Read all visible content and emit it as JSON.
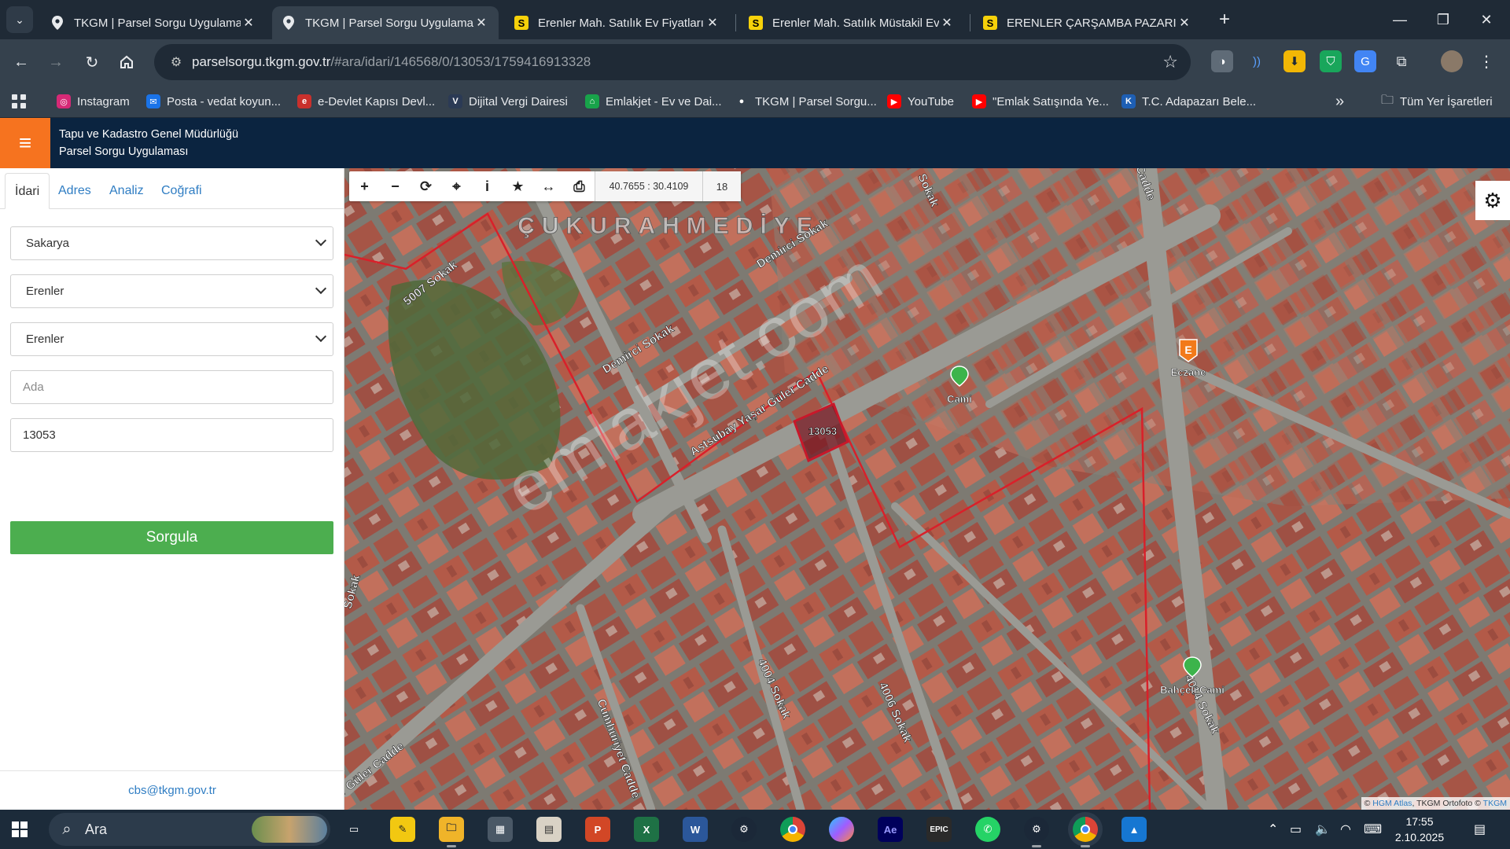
{
  "browser": {
    "tabs": [
      {
        "title": "TKGM | Parsel Sorgu Uygulaması",
        "favicon": "map-pin-icon",
        "active": false
      },
      {
        "title": "TKGM | Parsel Sorgu Uygulaması",
        "favicon": "map-pin-icon",
        "active": true
      },
      {
        "title": "Erenler Mah. Satılık Ev Fiyatları s",
        "favicon": "sahibinden-icon",
        "active": false
      },
      {
        "title": "Erenler Mah. Satılık Müstakil Ev",
        "favicon": "sahibinden-icon",
        "active": false
      },
      {
        "title": "ERENLER ÇARŞAMBA PAZARI M",
        "favicon": "sahibinden-icon",
        "active": false
      }
    ],
    "favicon_letter": "S",
    "url_host": "parselsorgu.tkgm.gov.tr",
    "url_path": "/#ara/idari/146568/0/13053/1759416913328",
    "bookmarks": [
      {
        "label": "Instagram",
        "icon": "instagram-icon",
        "color": "#d62976"
      },
      {
        "label": "Posta - vedat koyun...",
        "icon": "mail-icon",
        "color": "#1a73e8"
      },
      {
        "label": "e-Devlet Kapısı Devl...",
        "icon": "edevlet-icon",
        "color": "#c9302c"
      },
      {
        "label": "Dijital Vergi Dairesi",
        "icon": "vergi-icon",
        "color": "#2b3a55"
      },
      {
        "label": "Emlakjet - Ev ve Dai...",
        "icon": "emlakjet-icon",
        "color": "#18a34a"
      },
      {
        "label": "TKGM | Parsel Sorgu...",
        "icon": "map-pin-icon",
        "color": "#555"
      },
      {
        "label": "YouTube",
        "icon": "youtube-icon",
        "color": "#ff0000"
      },
      {
        "label": "\"Emlak Satışında Ye...",
        "icon": "youtube-icon",
        "color": "#ff0000"
      },
      {
        "label": "T.C. Adapazarı Bele...",
        "icon": "belediye-icon",
        "color": "#1e5fb4"
      }
    ],
    "bookmarks_more": "»",
    "all_bookmarks": "Tüm Yer İşaretleri"
  },
  "app": {
    "title_line1": "Tapu ve Kadastro Genel Müdürlüğü",
    "title_line2": "Parsel Sorgu Uygulaması"
  },
  "sidebar": {
    "tabs": [
      "İdari",
      "Adres",
      "Analiz",
      "Coğrafi"
    ],
    "active_tab": "İdari",
    "il": "Sakarya",
    "ilce": "Erenler",
    "mahalle": "Erenler",
    "ada_placeholder": "Ada",
    "parsel_value": "13053",
    "query_button": "Sorgula",
    "footer_email": "cbs@tkgm.gov.tr"
  },
  "map": {
    "coordinates": "40.7655 : 30.4109",
    "zoom_level": "18",
    "parcel_label": "13053",
    "neighborhood_label": "ÇUKURAHMEDİYE",
    "watermark": "emlakjet.com",
    "streets": [
      "5007 Sokak",
      "Demirci Sokak",
      "Demirci Sokak",
      "Astsubay Yaşar Güler Cadde",
      "Yaşar Güler Cadde",
      "Cumhuriyet Cadde",
      "4004 Sokak",
      "4006 Sokak",
      "4014 Sokak",
      "Sokak",
      "Sokak",
      "Cadde"
    ],
    "pois": [
      {
        "label": "Cami",
        "icon": "mosque-icon",
        "color": "#3cb44b"
      },
      {
        "label": "Eczane",
        "icon": "pharmacy-icon",
        "color": "#f27a1a"
      },
      {
        "label": "Bahçeli Cami",
        "icon": "mosque-icon",
        "color": "#3cb44b"
      }
    ],
    "attribution_prefix": "© ",
    "attribution_hgm": "HGM Atlas",
    "attribution_mid": ", TKGM Ortofoto © ",
    "attribution_tkgm": "TKGM",
    "boundary_color": "#d9202a"
  },
  "taskbar": {
    "search_label": "Ara",
    "time": "17:55",
    "date": "2.10.2025",
    "apps": [
      {
        "icon": "task-view-icon",
        "label": ""
      },
      {
        "icon": "sticky-notes-icon",
        "label": ""
      },
      {
        "icon": "file-explorer-icon",
        "label": ""
      },
      {
        "icon": "calculator-icon",
        "label": ""
      },
      {
        "icon": "office-icon",
        "label": ""
      },
      {
        "icon": "powerpoint-icon",
        "label": "P"
      },
      {
        "icon": "excel-icon",
        "label": "X"
      },
      {
        "icon": "word-icon",
        "label": "W"
      },
      {
        "icon": "steam-icon",
        "label": ""
      },
      {
        "icon": "chrome-icon",
        "label": ""
      },
      {
        "icon": "copilot-icon",
        "label": ""
      },
      {
        "icon": "after-effects-icon",
        "label": "Ae"
      },
      {
        "icon": "epic-games-icon",
        "label": "EPIC"
      },
      {
        "icon": "whatsapp-icon",
        "label": ""
      },
      {
        "icon": "steam-icon",
        "label": ""
      },
      {
        "icon": "chrome-icon",
        "label": ""
      },
      {
        "icon": "photos-icon",
        "label": ""
      }
    ]
  }
}
